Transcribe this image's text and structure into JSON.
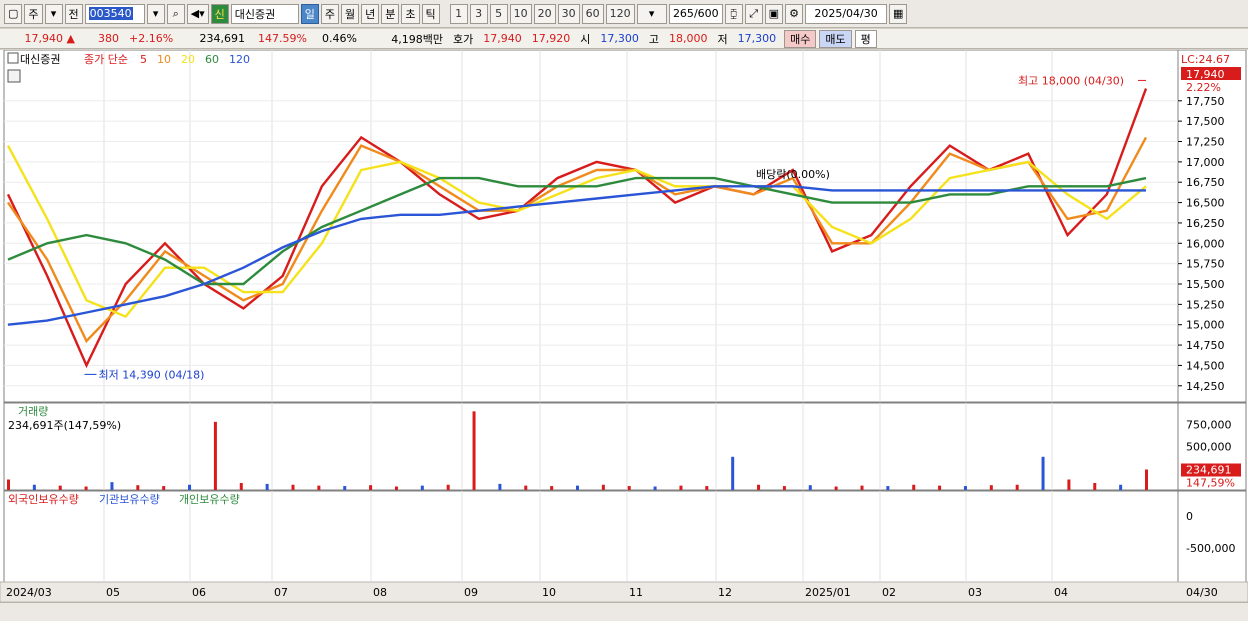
{
  "toolbar": {
    "period_week": "주",
    "prev_label": "전",
    "stock_code": "003540",
    "stock_name": "대신증권",
    "sin_label": "신",
    "tabs": [
      "일",
      "주",
      "월",
      "년",
      "분",
      "초",
      "틱"
    ],
    "active_tab": "일",
    "intervals": [
      "1",
      "3",
      "5",
      "10",
      "20",
      "30",
      "60",
      "120"
    ],
    "bar_count": "265",
    "bar_total": "/600",
    "date": "2025/04/30"
  },
  "quote": {
    "price": "17,940",
    "change": "380",
    "change_pct": "+2.16%",
    "volume": "234,691",
    "vol_ratio": "147.59%",
    "turnover": "0.46%",
    "amount": "4,198백만",
    "bid_label": "호가",
    "ask": "17,940",
    "bid": "17,920",
    "open_label": "시",
    "open": "17,300",
    "high_label": "고",
    "high": "18,000",
    "low_label": "저",
    "low": "17,300",
    "buy_label": "매수",
    "sell_label": "매도",
    "eq_label": "평"
  },
  "legend": {
    "name": "대신증권",
    "ma_label": "종가 단순",
    "periods": [
      "5",
      "10",
      "20",
      "60",
      "120"
    ],
    "colors": {
      "5": "#d81b1b",
      "10": "#f08a1c",
      "20": "#f5e21a",
      "60": "#2e8b3e",
      "120": "#2a55d6"
    }
  },
  "annotations": {
    "lc": "LC:24.67",
    "last_price": "17,940",
    "last_pct": "2.22%",
    "high_note": "최고 18,000 (04/30)",
    "low_note": "최저 14,390 (04/18)",
    "overlay": "배당락(0.00%)"
  },
  "volume_panel": {
    "title": "거래량",
    "summary": "234,691주(147,59%)",
    "last_vol": "234,691",
    "last_pct": "147,59%"
  },
  "holder_panel": {
    "legend": [
      "외국인보유수량",
      "기관보유수량",
      "개인보유수량"
    ],
    "colors": [
      "#d81b1b",
      "#2a55d6",
      "#2e8b3e"
    ]
  },
  "axis_right_label": "04/30",
  "chart_data": [
    {
      "type": "line",
      "title": "대신증권",
      "x": [
        "2024/03",
        "05",
        "06",
        "07",
        "08",
        "09",
        "10",
        "11",
        "12",
        "2025/01",
        "02",
        "03",
        "04"
      ],
      "ylim": [
        14100,
        18300
      ],
      "yticks": [
        14250,
        14500,
        14750,
        15000,
        15250,
        15500,
        15750,
        16000,
        16250,
        16500,
        16750,
        17000,
        17250,
        17500,
        17750
      ],
      "ytick_labels": [
        "14,250",
        "14,500",
        "14,750",
        "15,000",
        "15,250",
        "15,500",
        "15,750",
        "16,000",
        "16,250",
        "16,500",
        "16,750",
        "17,000",
        "17,250",
        "17,500",
        "17,750"
      ],
      "series": [
        {
          "name": "5",
          "color": "#d81b1b",
          "values": [
            16600,
            15600,
            14500,
            15500,
            16000,
            15500,
            15200,
            15600,
            16700,
            17300,
            17000,
            16600,
            16300,
            16400,
            16800,
            17000,
            16900,
            16500,
            16700,
            16600,
            16900,
            15900,
            16100,
            16700,
            17200,
            16900,
            17100,
            16100,
            16600,
            17900
          ]
        },
        {
          "name": "10",
          "color": "#f08a1c",
          "values": [
            16500,
            15800,
            14800,
            15300,
            15900,
            15600,
            15300,
            15500,
            16400,
            17200,
            17000,
            16700,
            16400,
            16400,
            16700,
            16900,
            16900,
            16600,
            16700,
            16600,
            16800,
            16000,
            16000,
            16500,
            17100,
            16900,
            17000,
            16300,
            16400,
            17300
          ]
        },
        {
          "name": "20",
          "color": "#f5e21a",
          "values": [
            17200,
            16300,
            15300,
            15100,
            15700,
            15700,
            15400,
            15400,
            16000,
            16900,
            17000,
            16800,
            16500,
            16400,
            16600,
            16800,
            16900,
            16700,
            16700,
            16700,
            16700,
            16200,
            16000,
            16300,
            16800,
            16900,
            17000,
            16600,
            16300,
            16700
          ]
        },
        {
          "name": "60",
          "color": "#2e8b3e",
          "values": [
            15800,
            16000,
            16100,
            16000,
            15800,
            15500,
            15500,
            15900,
            16200,
            16400,
            16600,
            16800,
            16800,
            16700,
            16700,
            16700,
            16800,
            16800,
            16800,
            16700,
            16600,
            16500,
            16500,
            16500,
            16600,
            16600,
            16700,
            16700,
            16700,
            16800
          ]
        },
        {
          "name": "120",
          "color": "#2a55d6",
          "values": [
            15000,
            15050,
            15150,
            15250,
            15350,
            15500,
            15700,
            15950,
            16150,
            16300,
            16350,
            16350,
            16400,
            16450,
            16500,
            16550,
            16600,
            16650,
            16700,
            16700,
            16700,
            16650,
            16650,
            16650,
            16650,
            16650,
            16650,
            16650,
            16650,
            16650
          ]
        }
      ],
      "markers": {
        "high": {
          "date": "04/30",
          "value": 18000
        },
        "low": {
          "date": "04/18",
          "value": 14390
        }
      }
    },
    {
      "type": "bar",
      "title": "거래량",
      "ylim": [
        0,
        950000
      ],
      "yticks": [
        0,
        500000,
        750000
      ],
      "ytick_labels": [
        "",
        "500,000",
        "750,000"
      ],
      "values": [
        120000,
        60000,
        50000,
        40000,
        90000,
        55000,
        45000,
        60000,
        780000,
        80000,
        70000,
        60000,
        50000,
        45000,
        55000,
        40000,
        50000,
        60000,
        900000,
        70000,
        50000,
        45000,
        50000,
        60000,
        45000,
        40000,
        50000,
        45000,
        380000,
        60000,
        45000,
        55000,
        40000,
        50000,
        45000,
        60000,
        50000,
        45000,
        55000,
        60000,
        380000,
        120000,
        80000,
        60000,
        234691
      ]
    }
  ]
}
